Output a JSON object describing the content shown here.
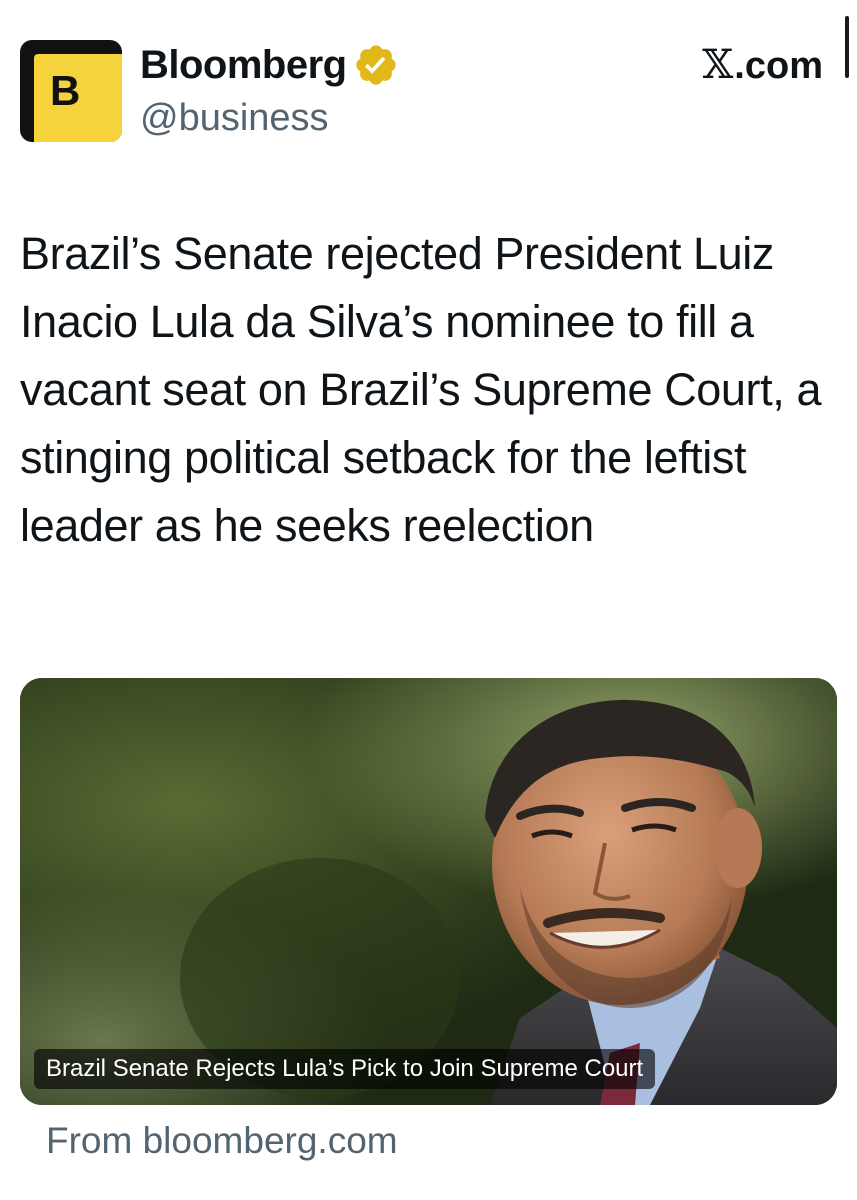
{
  "header": {
    "display_name": "Bloomberg",
    "handle": "@business",
    "avatar_letter": "B",
    "verified": true,
    "verified_icon": "gold-verified-badge-icon",
    "source_x": "𝕏",
    "source_domain": ".com"
  },
  "tweet": {
    "text": "Brazil’s Senate rejected President Luiz Inacio Lula da Silva’s nominee to fill a vacant seat on Brazil’s Supreme Court, a stinging political setback for the leftist leader as he seeks reelection"
  },
  "link_card": {
    "caption": "Brazil Senate Rejects Lula’s Pick to Join Supreme Court",
    "from_text": "From bloomberg.com"
  },
  "colors": {
    "text": "#0f1419",
    "secondary_text": "#536471",
    "brand_yellow": "#f6d23c",
    "verified_gold": "#e2b719"
  }
}
